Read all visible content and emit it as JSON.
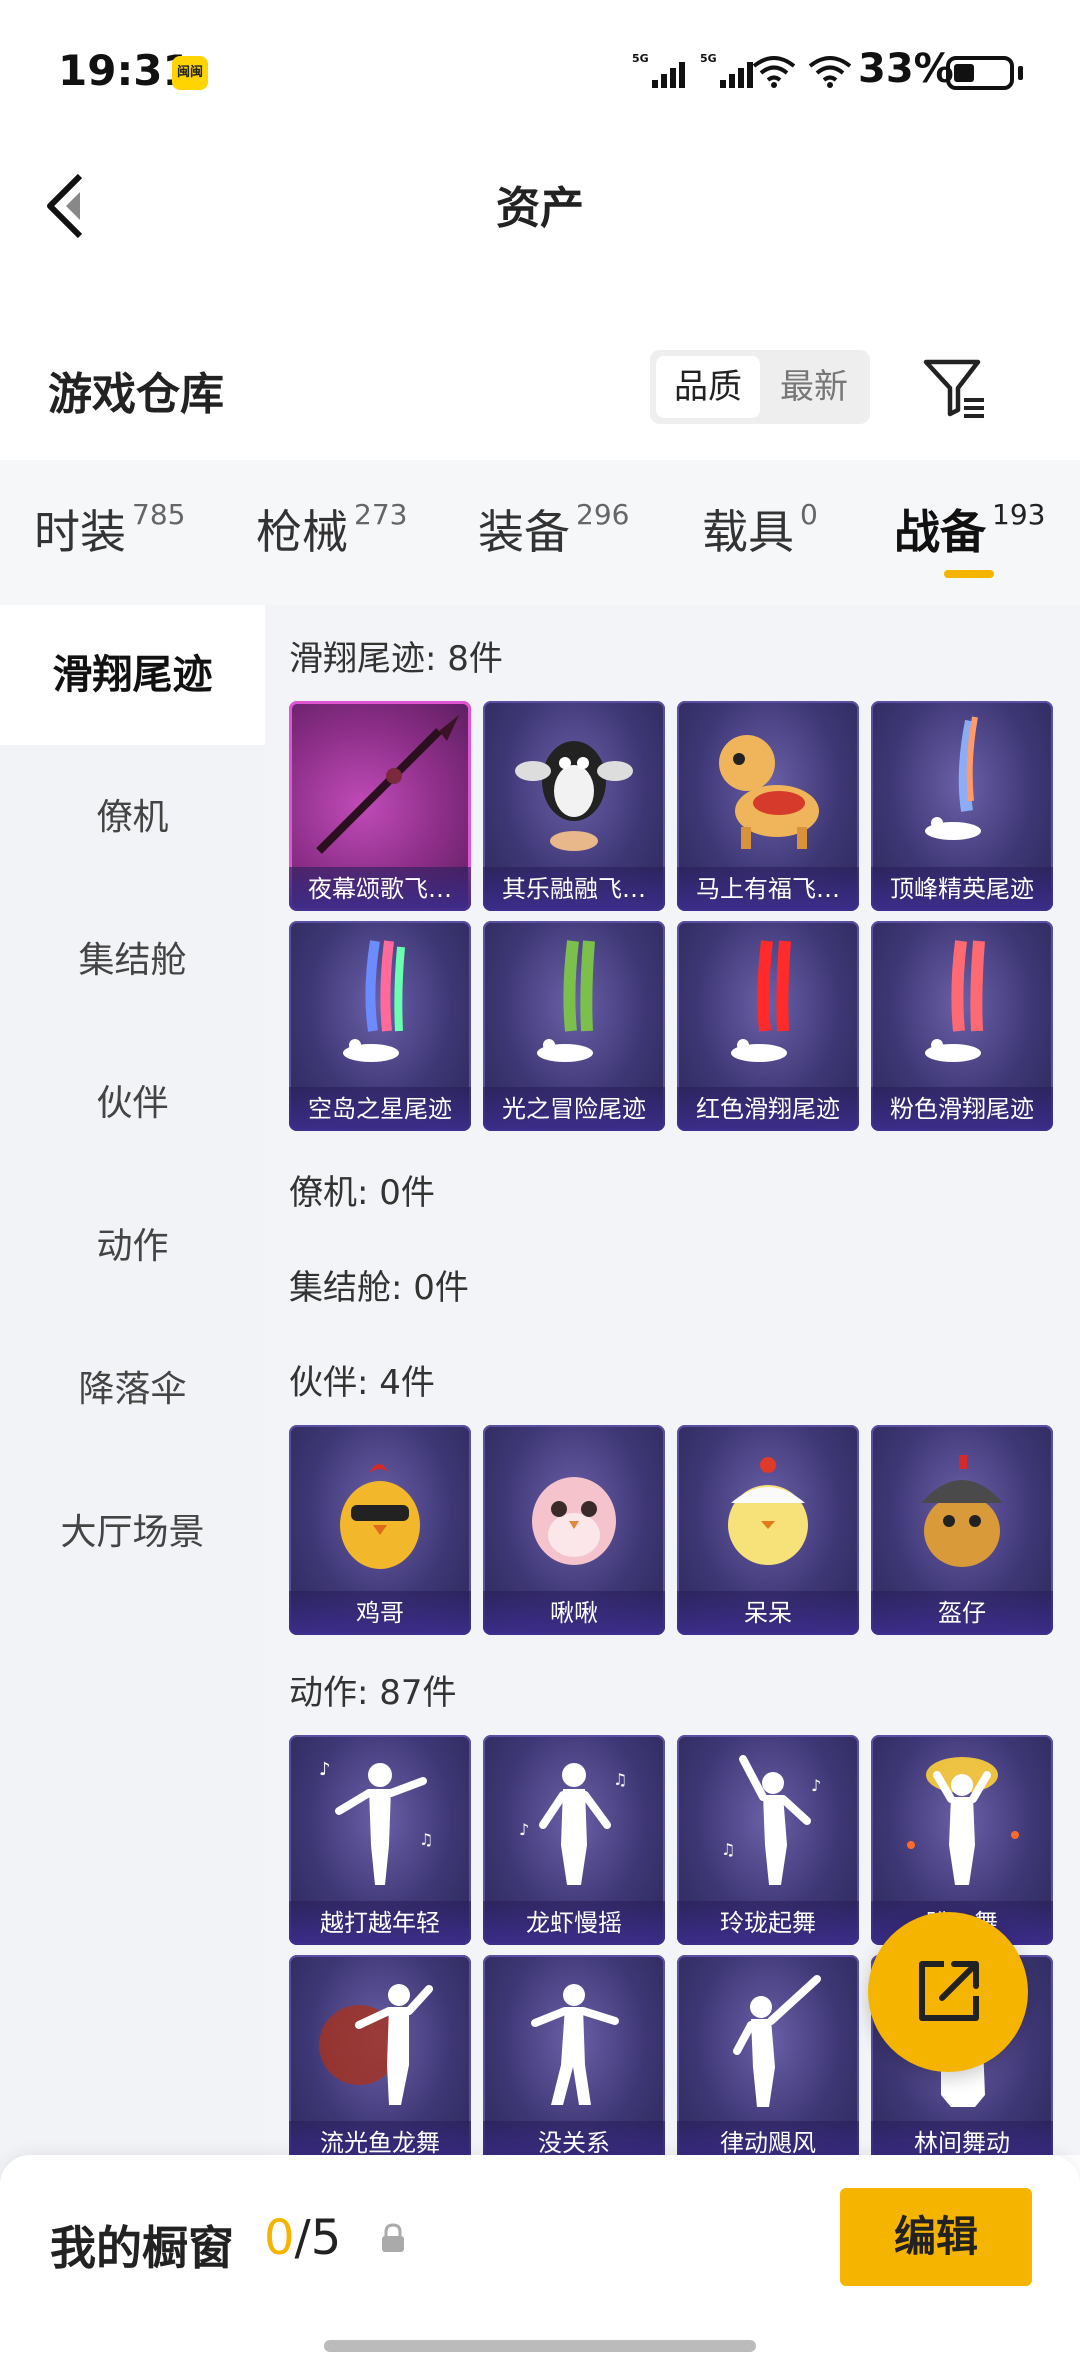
{
  "status_bar": {
    "time": "19:31",
    "app_badge": "闽闽",
    "network1": "5G",
    "network2": "5G",
    "battery": "33%"
  },
  "header": {
    "title": "资产"
  },
  "warehouse": {
    "title": "游戏仓库",
    "sort_options": [
      "品质",
      "最新"
    ],
    "selected_sort": "品质"
  },
  "tabs": [
    {
      "label": "时装",
      "count": "785"
    },
    {
      "label": "枪械",
      "count": "273"
    },
    {
      "label": "装备",
      "count": "296"
    },
    {
      "label": "载具",
      "count": "0"
    },
    {
      "label": "战备",
      "count": "193",
      "active": true
    }
  ],
  "sidebar": {
    "items": [
      "滑翔尾迹",
      "僚机",
      "集结舱",
      "伙伴",
      "动作",
      "降落伞",
      "大厅场景"
    ],
    "active": "滑翔尾迹"
  },
  "sections": {
    "glide": {
      "title": "滑翔尾迹: 8件",
      "items": [
        "夜幕颂歌飞…",
        "其乐融融飞…",
        "马上有福飞…",
        "顶峰精英尾迹",
        "空岛之星尾迹",
        "光之冒险尾迹",
        "红色滑翔尾迹",
        "粉色滑翔尾迹"
      ]
    },
    "wingman": {
      "title": "僚机: 0件"
    },
    "pod": {
      "title": "集结舱: 0件"
    },
    "partner": {
      "title": "伙伴: 4件",
      "items": [
        "鸡哥",
        "啾啾",
        "呆呆",
        "盔仔"
      ]
    },
    "emote": {
      "title": "动作: 87件",
      "items": [
        "越打越年轻",
        "龙虾慢摇",
        "玲珑起舞",
        "",
        "流光鱼龙舞",
        "没关系",
        "律动飓风",
        "林间舞动"
      ],
      "partial_label_4": "盼…舞"
    }
  },
  "showcase": {
    "label": "我的橱窗",
    "current": "0",
    "total": "/5",
    "edit_label": "编辑"
  },
  "colors": {
    "accent": "#f5b400",
    "card_bg": "#3e3775",
    "card_highlight": "#c04bb8"
  }
}
